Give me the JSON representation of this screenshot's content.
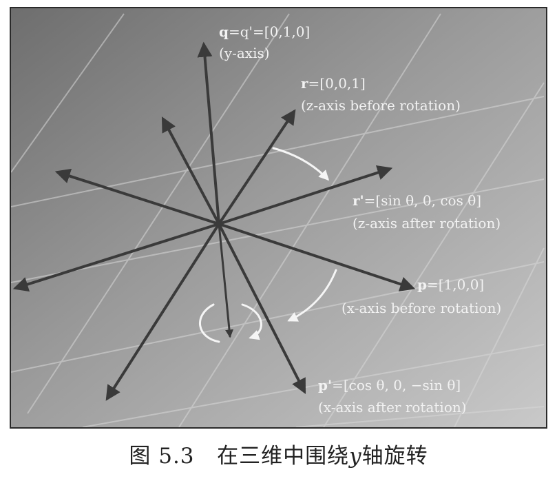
{
  "labels": {
    "q_bold": "q",
    "q_rest": "=q'=[0,1,0]",
    "q_sub": "(y-axis)",
    "r_bold": "r",
    "r_rest": "=[0,0,1]",
    "r_sub": "(z-axis before rotation)",
    "rp_bold": "r'",
    "rp_rest": "=[sin θ, 0, cos θ]",
    "rp_sub": "(z-axis after rotation)",
    "p_bold": "p",
    "p_rest": "=[1,0,0]",
    "p_sub": "(x-axis before rotation)",
    "pp_bold": "p'",
    "pp_rest": "=[cos θ, 0, −sin θ]",
    "pp_sub": "(x-axis after rotation)"
  },
  "caption": {
    "figure_no": "图 5.3",
    "text_before": "在三维中围绕",
    "axis": "y",
    "text_after": "轴旋转"
  },
  "colors": {
    "arrow": "#3a3a3a",
    "arc": "#f5f5f5",
    "label": "#f2f2f2",
    "grid": "#d8d8d8"
  }
}
